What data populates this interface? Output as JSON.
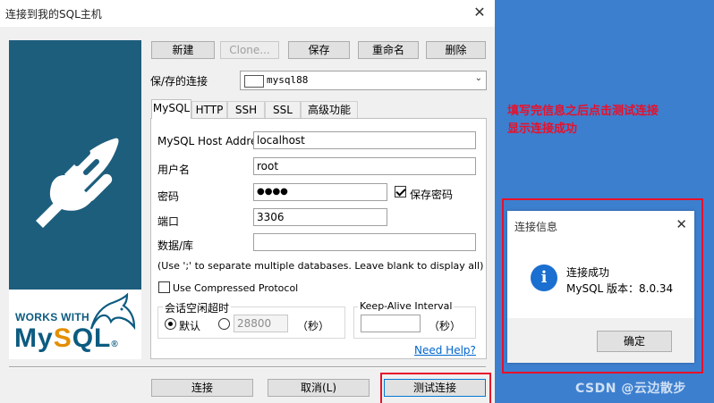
{
  "window": {
    "title": "连接到我的SQL主机",
    "close": "✕"
  },
  "logo": {
    "works_with": "WORKS WITH",
    "brand_prefix": "My",
    "brand_q": "S",
    "brand_suffix": "QL",
    "reg": "®"
  },
  "toolbar": {
    "new": "新建",
    "clone": "Clone...",
    "save": "保存",
    "rename": "重命名",
    "delete": "删除"
  },
  "saved_connection": {
    "label": "保/存的连接",
    "value": "mysql88",
    "arrow": "⌄"
  },
  "tabs": [
    {
      "label": "MySQL",
      "active": true
    },
    {
      "label": "HTTP"
    },
    {
      "label": "SSH"
    },
    {
      "label": "SSL"
    },
    {
      "label": "高级功能"
    }
  ],
  "form": {
    "host_label": "MySQL Host Address",
    "host_value": "localhost",
    "user_label": "用户名",
    "user_value": "root",
    "password_label": "密码",
    "password_value": "●●●●",
    "save_password_label": "保存密码",
    "port_label": "端口",
    "port_value": "3306",
    "database_label": "数据/库",
    "database_value": "",
    "hint": "(Use ';' to separate multiple databases. Leave blank to display all)",
    "compressed_label": "Use Compressed Protocol",
    "session_group_title": "会话空闲超时",
    "default_label": "默认",
    "timeout_value": "28800",
    "seconds_1": "（秒）",
    "keepalive_title": "Keep-Alive Interval",
    "keepalive_value": "",
    "seconds_2": "（秒）",
    "help_link": "Need Help?"
  },
  "footer": {
    "connect": "连接",
    "cancel": "取消(L)",
    "test": "测试连接"
  },
  "annotation": {
    "line1": "填写完信息之后点击测试连接",
    "line2": "显示连接成功"
  },
  "info_dialog": {
    "title": "连接信息",
    "close": "✕",
    "icon": "i",
    "line1": "连接成功",
    "line2": "MySQL 版本：8.0.34",
    "ok": "确定"
  },
  "watermark": "CSDN @云边散步",
  "colors": {
    "sidebar": "#1d5e7d",
    "annotation_red": "#e8102a",
    "desktop_blue": "#3d7fcf",
    "info_icon": "#1a6fd0"
  }
}
